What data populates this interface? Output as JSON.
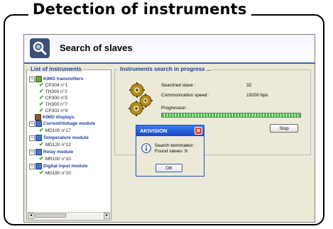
{
  "caption": "Detection of instruments",
  "window": {
    "title": "Search of slaves"
  },
  "list_panel": {
    "title": "List of instruments",
    "items": [
      {
        "label": "KIMO transmitters",
        "level": 0,
        "expanded": true
      },
      {
        "label": "CP304 n°1",
        "level": 1
      },
      {
        "label": "TH300 n°2",
        "level": 1
      },
      {
        "label": "CP300 n°5",
        "level": 1
      },
      {
        "label": "TH300 n°7",
        "level": 1
      },
      {
        "label": "CP302 n°9",
        "level": 1
      },
      {
        "label": "KIMO displays",
        "level": 0
      },
      {
        "label": "Current/Voltage module",
        "level": 0,
        "expanded": true
      },
      {
        "label": "MD100 n°17",
        "level": 1
      },
      {
        "label": "Temperature module",
        "level": 0,
        "expanded": true
      },
      {
        "label": "MD120 n°12",
        "level": 1
      },
      {
        "label": "Relay module",
        "level": 0,
        "expanded": true
      },
      {
        "label": "MR100 n°10",
        "level": 1
      },
      {
        "label": "Digital input module",
        "level": 0,
        "expanded": true
      },
      {
        "label": "MD180 n°20",
        "level": 1
      }
    ]
  },
  "search_panel": {
    "title": "Instruments search in progress ...",
    "searched_slave_label": "Searched slave :",
    "searched_slave_value": "32",
    "comm_speed_label": "Communication speed :",
    "comm_speed_value": "19200 bps",
    "progression_label": "Progression",
    "progress_fraction": 1.0,
    "stop_label": "Stop"
  },
  "dialog": {
    "title": "AKIVISION",
    "line1": "Search terminated :",
    "line2": "Found slaves :9",
    "ok_label": "OK"
  },
  "colors": {
    "accent": "#1e3fa0",
    "progress": "#3cc43c",
    "dialog_title": "#1f4fbf",
    "close_button": "#d8481f"
  }
}
